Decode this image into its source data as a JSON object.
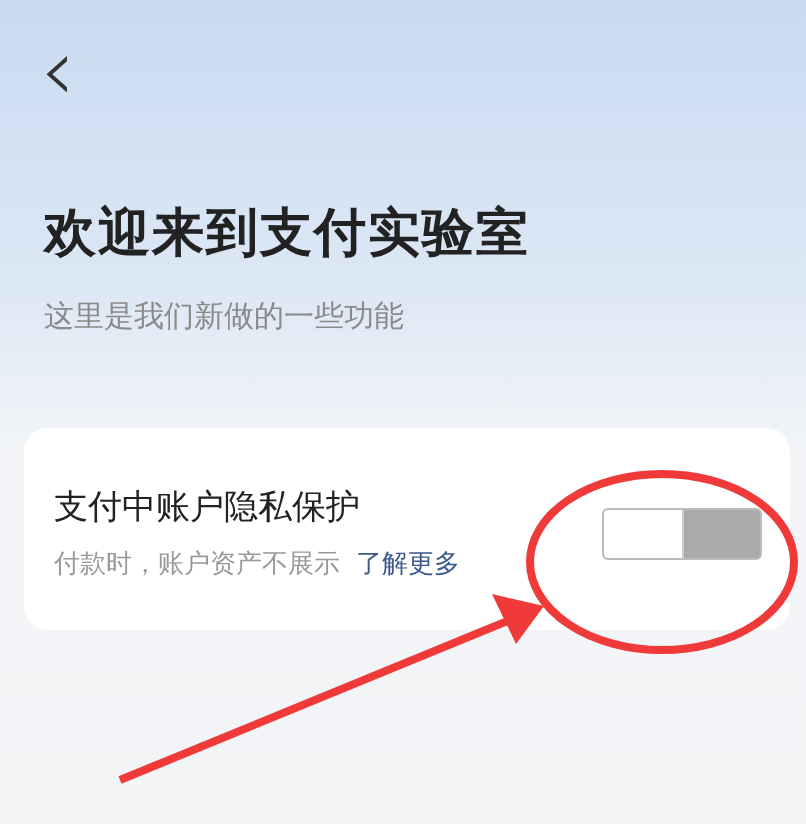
{
  "header": {
    "back": "‹"
  },
  "intro": {
    "title": "欢迎来到支付实验室",
    "subtitle": "这里是我们新做的一些功能"
  },
  "settings": [
    {
      "title": "支付中账户隐私保护",
      "description": "付款时，账户资产不展示",
      "link": "了解更多",
      "on": false
    }
  ]
}
